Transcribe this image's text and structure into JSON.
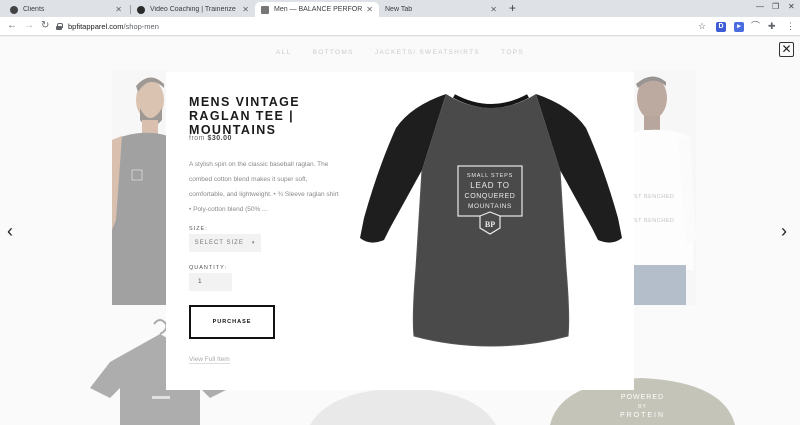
{
  "browser": {
    "tabs": [
      {
        "title": "Clients",
        "favicon_color": "#444444"
      },
      {
        "title": "Video Coaching | Trainerize Pers",
        "favicon_color": "#2b2b2b"
      },
      {
        "title": "Men — BALANCE PERFORMANC",
        "favicon_color": "#777777"
      },
      {
        "title": "New Tab",
        "favicon_color": "none"
      }
    ],
    "url_host": "bpfitapparel.com",
    "url_path": "/shop-men"
  },
  "category_nav": [
    "ALL",
    "BOTTOMS",
    "JACKETS/ SWEATSHIRTS",
    "TOPS"
  ],
  "product_modal": {
    "title": "MENS VINTAGE RAGLAN TEE | MOUNTAINS",
    "price_prefix": "from",
    "price": "$30.00",
    "description": "A stylish spin on the classic baseball raglan. The combed cotton blend makes it super soft, comfortable, and lightweight. • ¾ Sleeve raglan shirt • Poly-cotton blend (50% ...",
    "size_label": "SIZE:",
    "size_placeholder": "SELECT SIZE",
    "quantity_label": "QUANTITY:",
    "quantity_value": "1",
    "purchase_label": "PURCHASE",
    "view_full_label": "View Full Item",
    "shirt_graphic_lines": [
      "SMALL STEPS",
      "LEAD TO",
      "CONQUERED",
      "MOUNTAINS"
    ],
    "logo_text": "BP"
  },
  "background_shirt_text": {
    "right_shirt": [
      "ST BENCHED",
      "ST BENCHED"
    ],
    "bottom_right_shirt": [
      "POWERED",
      "BY",
      "PROTEIN"
    ]
  },
  "colors": {
    "modal_bg": "#ffffff",
    "purchase_border": "#111111",
    "heather_body": "#4a4a4a",
    "black_sleeves": "#1e1e1e"
  }
}
